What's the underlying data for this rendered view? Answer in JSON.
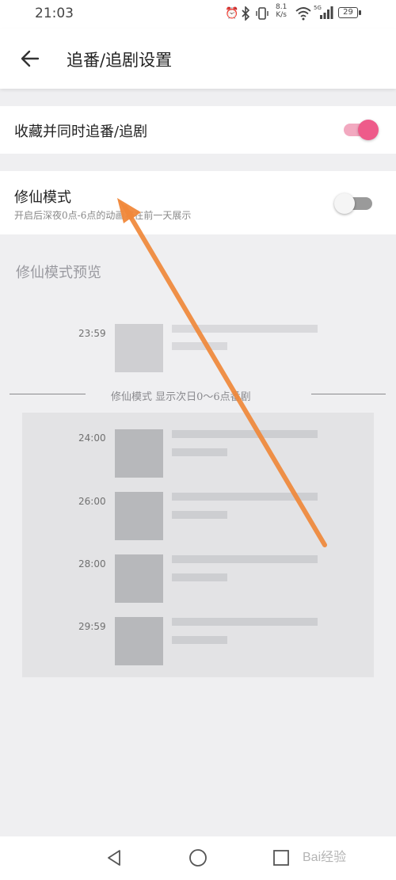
{
  "status_bar": {
    "time": "21:03",
    "net_speed_value": "8.1",
    "net_speed_unit": "K/s",
    "signal_label": "5G",
    "battery": "29"
  },
  "header": {
    "title": "追番/追剧设置"
  },
  "settings": {
    "sync_label": "收藏并同时追番/追剧",
    "sync_enabled": true,
    "mode_label": "修仙模式",
    "mode_description": "开启后深夜0点-6点的动画将在前一天展示",
    "mode_enabled": false
  },
  "preview": {
    "title": "修仙模式预览",
    "before_time": "23:59",
    "divider_text": "修仙模式 显示次日0～6点番剧",
    "times": [
      "24:00",
      "26:00",
      "28:00",
      "29:59"
    ]
  },
  "watermark": "Bai经验",
  "colors": {
    "accent": "#ee5b8a",
    "arrow": "#f0883a"
  }
}
